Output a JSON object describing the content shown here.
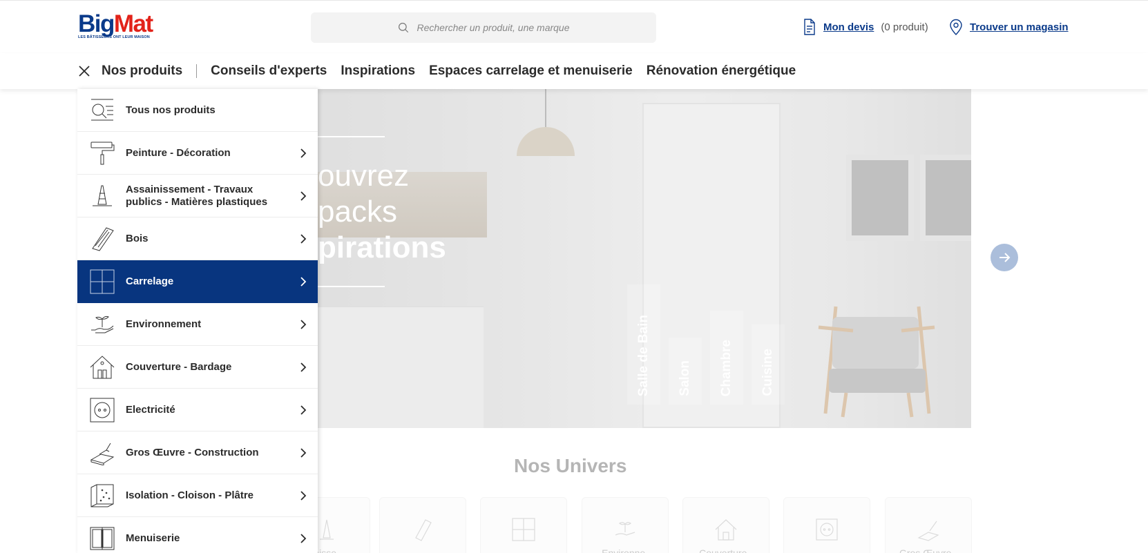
{
  "brand": {
    "logo_big": "Big",
    "logo_mat": "Mat",
    "tagline": "LES BÂTISSEURS ONT LEUR MAISON",
    "primary": "#08357f",
    "accent": "#e2231a"
  },
  "header": {
    "search_placeholder": "Rechercher un produit, une marque",
    "devis_label": "Mon devis",
    "devis_count": "(0 produit)",
    "store_label": "Trouver un magasin"
  },
  "nav": {
    "products": "Nos produits",
    "items": [
      "Conseils d'experts",
      "Inspirations",
      "Espaces carrelage et menuiserie",
      "Rénovation énergétique"
    ]
  },
  "menu": {
    "items": [
      {
        "label": "Tous nos produits",
        "icon": "search-list-icon"
      },
      {
        "label": "Peinture - Décoration",
        "icon": "paint-roller-icon"
      },
      {
        "label": "Assainissement - Travaux publics - Matières plastiques",
        "icon": "traffic-cone-icon"
      },
      {
        "label": "Bois",
        "icon": "wood-plank-icon"
      },
      {
        "label": "Carrelage",
        "icon": "tile-icon"
      },
      {
        "label": "Environnement",
        "icon": "hand-plant-icon"
      },
      {
        "label": "Couverture - Bardage",
        "icon": "house-roof-icon"
      },
      {
        "label": "Electricité",
        "icon": "power-socket-icon"
      },
      {
        "label": "Gros Œuvre - Construction",
        "icon": "trowel-brick-icon"
      },
      {
        "label": "Isolation - Cloison - Plâtre",
        "icon": "insulation-icon"
      },
      {
        "label": "Menuiserie",
        "icon": "window-icon"
      }
    ],
    "active_index": 4
  },
  "hero": {
    "line1": "ouvrez",
    "line2": "packs",
    "line3": "piration s",
    "rooms": [
      "Salle de Bain",
      "Salon",
      "Chambre",
      "Cuisine"
    ]
  },
  "univers": {
    "title": "Nos Univers",
    "cards": [
      "nisse-",
      "",
      "",
      "Environne-",
      "Couverture -",
      "",
      "Gros Œuvre -"
    ]
  }
}
